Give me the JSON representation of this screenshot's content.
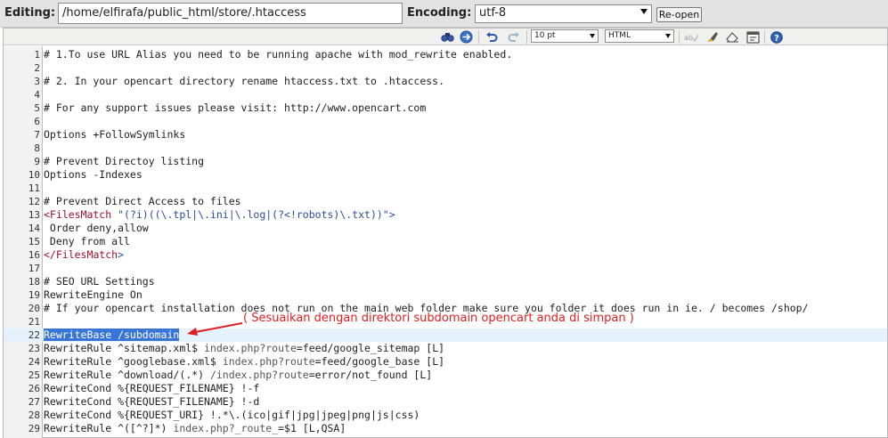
{
  "editing": {
    "label": "Editing:",
    "path": "/home/elfirafa/public_html/store/.htaccess"
  },
  "encoding": {
    "label": "Encoding:",
    "value": "utf-8"
  },
  "reopen_label": "Re-open",
  "toolbar": {
    "font_size": "10 pt",
    "syntax": "HTML"
  },
  "annotation": "( Sesuaikan dengan direktori subdomain opencart anda di simpan )",
  "lines": [
    {
      "n": "1",
      "segs": [
        {
          "t": "# 1.To use URL Alias you need to be running apache with mod_rewrite enabled."
        }
      ]
    },
    {
      "n": "2",
      "segs": []
    },
    {
      "n": "3",
      "segs": [
        {
          "t": "# 2. In your opencart directory rename htaccess.txt to .htaccess."
        }
      ]
    },
    {
      "n": "4",
      "segs": []
    },
    {
      "n": "5",
      "segs": [
        {
          "t": "# For any support issues please visit: http://www.opencart.com"
        }
      ]
    },
    {
      "n": "6",
      "segs": []
    },
    {
      "n": "7",
      "segs": [
        {
          "t": "Options +FollowSymlinks"
        }
      ]
    },
    {
      "n": "8",
      "segs": []
    },
    {
      "n": "9",
      "segs": [
        {
          "t": "# Prevent Directoy listing"
        }
      ]
    },
    {
      "n": "10",
      "segs": [
        {
          "t": "Options -Indexes"
        }
      ]
    },
    {
      "n": "11",
      "segs": []
    },
    {
      "n": "12",
      "segs": [
        {
          "t": "# Prevent Direct Access to files"
        }
      ]
    },
    {
      "n": "13",
      "segs": [
        {
          "t": "<FilesMatch",
          "c": "tag"
        },
        {
          "t": " \"(?i)((\\.tpl|\\.ini|\\.log|(?<!robots)\\.txt))\">",
          "c": "str"
        }
      ]
    },
    {
      "n": "14",
      "segs": [
        {
          "t": " Order deny,allow"
        }
      ]
    },
    {
      "n": "15",
      "segs": [
        {
          "t": " Deny from all"
        }
      ]
    },
    {
      "n": "16",
      "segs": [
        {
          "t": "</FilesMatch",
          "c": "tag"
        },
        {
          "t": ">",
          "c": "punct"
        }
      ]
    },
    {
      "n": "17",
      "segs": []
    },
    {
      "n": "18",
      "segs": [
        {
          "t": "# SEO URL Settings"
        }
      ]
    },
    {
      "n": "19",
      "segs": [
        {
          "t": "RewriteEngine On"
        }
      ]
    },
    {
      "n": "20",
      "segs": [
        {
          "t": "# If your opencart installation does not run on the main web folder make sure you folder it does run in ie. / becomes /shop/"
        }
      ]
    },
    {
      "n": "21",
      "segs": []
    },
    {
      "n": "22",
      "segs": [
        {
          "t": "RewriteBase /subdomain",
          "c": "sel"
        }
      ]
    },
    {
      "n": "23",
      "segs": [
        {
          "t": "RewriteRule ^sitemap.xml$ "
        },
        {
          "t": "index.php?route",
          "c": "url"
        },
        {
          "t": "=feed/google_sitemap [L]"
        }
      ]
    },
    {
      "n": "24",
      "segs": [
        {
          "t": "RewriteRule ^googlebase.xml$ "
        },
        {
          "t": "index.php?route",
          "c": "url"
        },
        {
          "t": "=feed/google_base [L]"
        }
      ]
    },
    {
      "n": "25",
      "segs": [
        {
          "t": "RewriteRule ^download/(.*) "
        },
        {
          "t": "/index.php?route",
          "c": "url"
        },
        {
          "t": "=error/not_found [L]"
        }
      ]
    },
    {
      "n": "26",
      "segs": [
        {
          "t": "RewriteCond %{REQUEST_FILENAME} !-f"
        }
      ]
    },
    {
      "n": "27",
      "segs": [
        {
          "t": "RewriteCond %{REQUEST_FILENAME} !-d"
        }
      ]
    },
    {
      "n": "28",
      "segs": [
        {
          "t": "RewriteCond %{REQUEST_URI} !.*\\.(ico|gif|jpg|jpeg|png|js|css)"
        }
      ]
    },
    {
      "n": "29",
      "segs": [
        {
          "t": "RewriteRule ^([^?]*) "
        },
        {
          "t": "index.php?_route_",
          "c": "url"
        },
        {
          "t": "=$1 [L,QSA]"
        }
      ]
    }
  ]
}
